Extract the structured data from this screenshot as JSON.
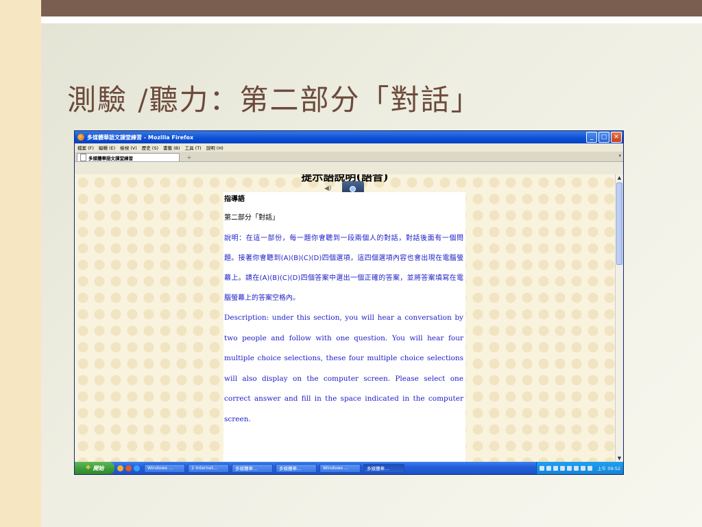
{
  "slide": {
    "title": "測驗 /聽力：第二部分「對話」"
  },
  "browser": {
    "window_title": "多媒體華語文課堂練習 - Mozilla Firefox",
    "menu": [
      "檔案 (F)",
      "編輯 (E)",
      "檢視 (V)",
      "歷史 (S)",
      "書籤 (B)",
      "工具 (T)",
      "說明 (H)"
    ],
    "tab_label": "多媒體華語文課堂練習",
    "new_tab_symbol": "+",
    "win_buttons": {
      "minimize": "_",
      "maximize": "□",
      "close": "✕"
    }
  },
  "page": {
    "heading": "提示語說明(語音)",
    "guide_label": "指導語",
    "part_label": "第二部分「對話」",
    "cn_description": "說明：在這一部份，每一題你會聽到一段兩個人的對話，對話後面有一個問題。接著你會聽到(A)(B)(C)(D)四個選項，這四個選項內容也會出現在電腦螢幕上。請在(A)(B)(C)(D)四個答案中選出一個正確的答案，並將答案填寫在電腦螢幕上的答案空格內。",
    "en_description": "Description: under this section, you will hear a conversation by two people and follow with one question. You will hear four multiple choice selections, these four multiple choice selections will also display on the computer screen. Please select one correct answer and fill in the space indicated in the computer screen."
  },
  "taskbar": {
    "start_label": "開始",
    "tasks": [
      "Windows ...",
      "2 Internet...",
      "多媒體華...",
      "多媒體華...",
      "Windows ...",
      "多媒體華..."
    ],
    "clock": "上午 09:52"
  },
  "colors": {
    "title_text": "#6b4a3c",
    "top_bar": "#7a5f51",
    "body_text_blue": "#1c1cc8"
  }
}
